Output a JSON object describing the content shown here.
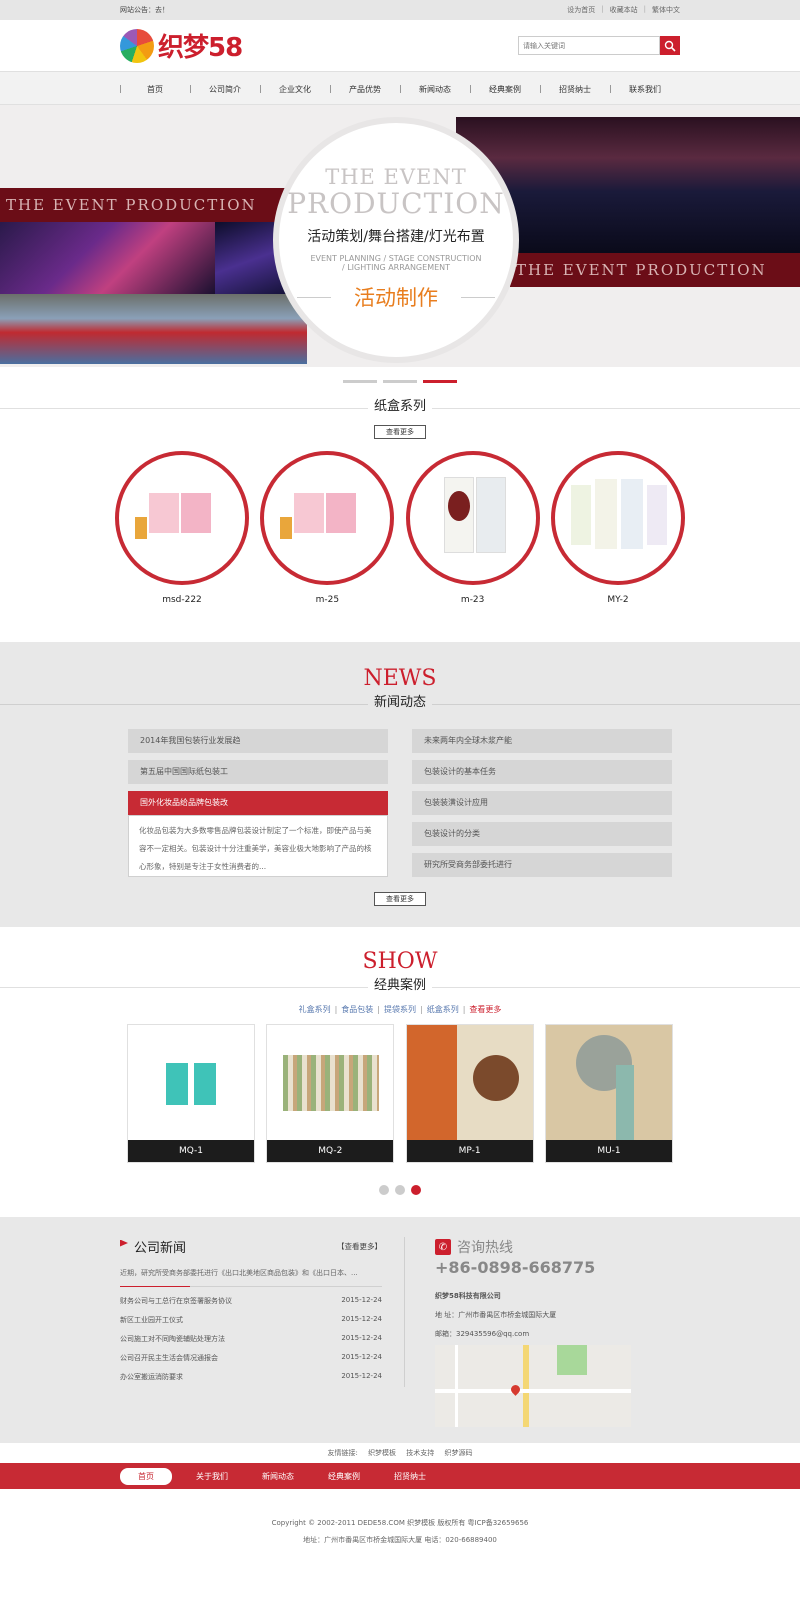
{
  "topbar": {
    "notice": "网站公告：去！",
    "links": [
      "设为首页",
      "收藏本站",
      "繁体中文"
    ]
  },
  "header": {
    "logo_text": "织梦58",
    "search_placeholder": "请输入关键词"
  },
  "nav": [
    "首页",
    "公司简介",
    "企业文化",
    "产品优势",
    "新闻动态",
    "经典案例",
    "招贤纳士",
    "联系我们"
  ],
  "banner": {
    "band_text": "THE EVENT PRODUCTION",
    "en1": "THE EVENT",
    "en2": "PRODUCTION",
    "cn_services": "活动策划/舞台搭建/灯光布置",
    "en_services_1": "EVENT PLANNING / STAGE CONSTRUCTION",
    "en_services_2": "/ LIGHTING ARRANGEMENT",
    "cn_highlight": "活动制作"
  },
  "cartons": {
    "title": "纸盒系列",
    "more": "查看更多",
    "items": [
      {
        "name": "msd-222"
      },
      {
        "name": "m-25"
      },
      {
        "name": "m-23"
      },
      {
        "name": "MY-2"
      }
    ]
  },
  "news": {
    "en": "NEWS",
    "title": "新闻动态",
    "left": [
      "2014年我国包装行业发展趋",
      "第五届中国国际纸包装工"
    ],
    "active_title": "国外化妆品给品牌包装改",
    "active_body": "化妆品包装为大多数零售品牌包装设计制定了一个标准，即使产品与美容不一定相关。包装设计十分注重美学，美容业极大地影响了产品的核心形象，特别是专注于女性消费者的...",
    "right": [
      "未来两年内全球木浆产能",
      "包装设计的基本任务",
      "包装装潢设计应用",
      "包装设计的分类",
      "研究所受商务部委托进行"
    ],
    "more": "查看更多"
  },
  "show": {
    "en": "SHOW",
    "title": "经典案例",
    "cats": [
      "礼盒系列",
      "食品包装",
      "提袋系列",
      "纸盒系列"
    ],
    "cats_more": "查看更多",
    "items": [
      {
        "name": "MQ-1"
      },
      {
        "name": "MQ-2"
      },
      {
        "name": "MP-1"
      },
      {
        "name": "MU-1"
      }
    ]
  },
  "company_news": {
    "title": "公司新闻",
    "more": "【查看更多】",
    "intro": "近期，研究所受商务部委托进行《出口北美地区商品包装》和《出口日本、...",
    "rows": [
      {
        "title": "财务公司与工总行在京签署服务协议",
        "date": "2015-12-24"
      },
      {
        "title": "新区工业园开工仪式",
        "date": "2015-12-24"
      },
      {
        "title": "公司施工对不同陶瓷辅贴处理方法",
        "date": "2015-12-24"
      },
      {
        "title": "公司召开民主生活会情况通报会",
        "date": "2015-12-24"
      },
      {
        "title": "办公室搬运消防要求",
        "date": "2015-12-24"
      }
    ]
  },
  "contact": {
    "title": "咨询热线",
    "phone": "+86-0898-668775",
    "company": "织梦58科技有限公司",
    "address": "地  址：广州市番禺区市桥金城国际大厦",
    "email": "邮箱：329435596@qq.com"
  },
  "friend_links": {
    "label": "友情链接:",
    "items": [
      "织梦模板",
      "技术支持",
      "织梦源码"
    ]
  },
  "footer_nav": [
    "首页",
    "关于我们",
    "新闻动态",
    "经典案例",
    "招贤纳士"
  ],
  "footer": {
    "copyright": "Copyright © 2002-2011 DEDE58.COM 织梦模板 版权所有 粤ICP备32659656",
    "address": "地址：广州市番禺区市桥金城国际大厦 电话：020-66889400"
  },
  "colors": {
    "brand_red": "#cc1f2d",
    "banner_band": "#6b0d17",
    "accent_orange": "#e87e1f"
  }
}
